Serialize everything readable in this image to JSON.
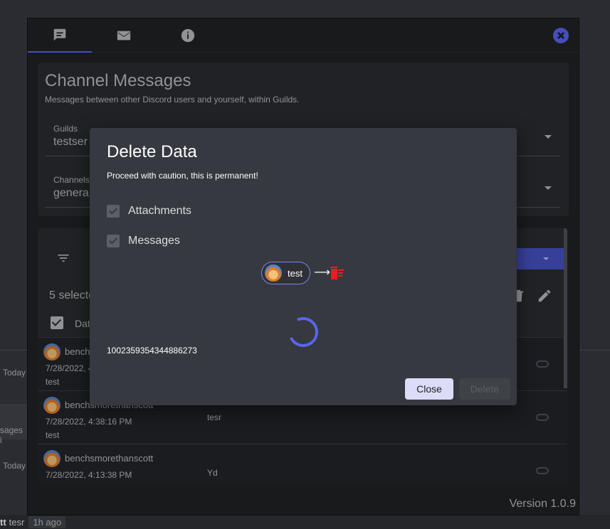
{
  "background": {
    "rows": [
      {
        "time": "Today"
      },
      {
        "snippet": "sages i"
      },
      {
        "time": "Today"
      }
    ],
    "footer": {
      "author": "tt",
      "text": "tesr",
      "ago": "1h ago"
    }
  },
  "tabs": [
    {
      "icon": "chat-icon"
    },
    {
      "icon": "mail-icon"
    },
    {
      "icon": "info-icon"
    }
  ],
  "panel": {
    "title": "Channel Messages",
    "subtitle": "Messages between other Discord users and yourself, within Guilds.",
    "guilds_label": "Guilds",
    "guilds_value": "testser",
    "channels_label": "Channels",
    "channels_value": "genera"
  },
  "table": {
    "selected_text": "5 selecte",
    "header_date": "Dat",
    "rows": [
      {
        "user": "bench",
        "date": "7/28/2022, 4",
        "message": "test",
        "content": ""
      },
      {
        "user": "benchsmorethanscott",
        "date": "7/28/2022, 4:38:16 PM",
        "message": "test",
        "content": "tesr"
      },
      {
        "user": "benchsmorethanscott",
        "date": "7/28/2022, 4:13:38 PM",
        "message": "",
        "content": "Yd"
      }
    ]
  },
  "version": "Version 1.0.9",
  "modal": {
    "title": "Delete Data",
    "warning": "Proceed with caution, this is permanent!",
    "options": [
      {
        "label": "Attachments",
        "checked": true
      },
      {
        "label": "Messages",
        "checked": true
      }
    ],
    "chip_name": "test",
    "arrow": "⟶",
    "message_id": "1002359354344886273",
    "close_label": "Close",
    "delete_label": "Delete"
  },
  "colors": {
    "accent": "#5865f2",
    "trash": "#ed1c24"
  }
}
